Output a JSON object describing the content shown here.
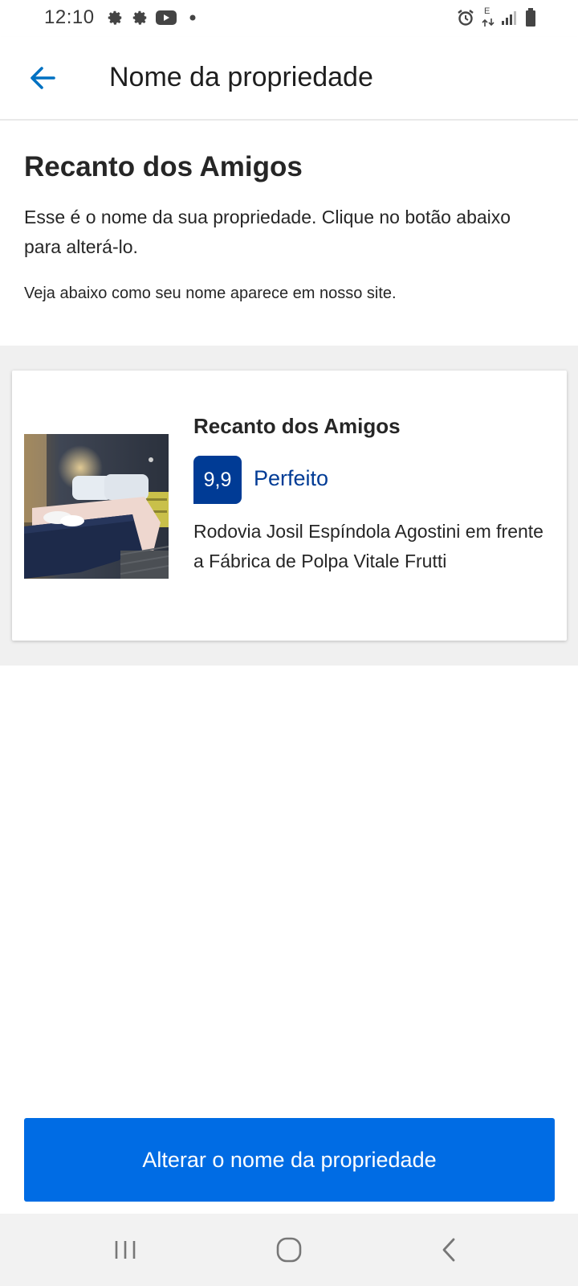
{
  "status_bar": {
    "time": "12:10",
    "left_icons": [
      "gear-icon",
      "gear-icon",
      "youtube-icon",
      "dot-icon"
    ],
    "right_icons": [
      "alarm-icon",
      "data-arrows-icon",
      "signal-icon",
      "battery-icon"
    ],
    "network_label": "E"
  },
  "app_bar": {
    "title": "Nome da propriedade",
    "back_icon": "arrow-left-icon"
  },
  "intro": {
    "title": "Recanto dos Amigos",
    "description": "Esse é o nome da sua propriedade. Clique no botão abaixo para alterá-lo.",
    "note": "Veja abaixo como seu nome aparece em nosso site."
  },
  "preview_card": {
    "name": "Recanto dos Amigos",
    "score": "9,9",
    "score_label": "Perfeito",
    "address": "Rodovia Josil Espíndola Agostini em frente a Fábrica de Polpa Vitale Frutti",
    "photo": "bedroom-photo"
  },
  "actions": {
    "primary_label": "Alterar o nome da propriedade"
  },
  "nav_bar": {
    "items": [
      "recents-icon",
      "home-icon",
      "back-icon"
    ]
  },
  "colors": {
    "brand_blue": "#003b95",
    "action_blue": "#006ce4",
    "back_arrow": "#0071c2"
  }
}
